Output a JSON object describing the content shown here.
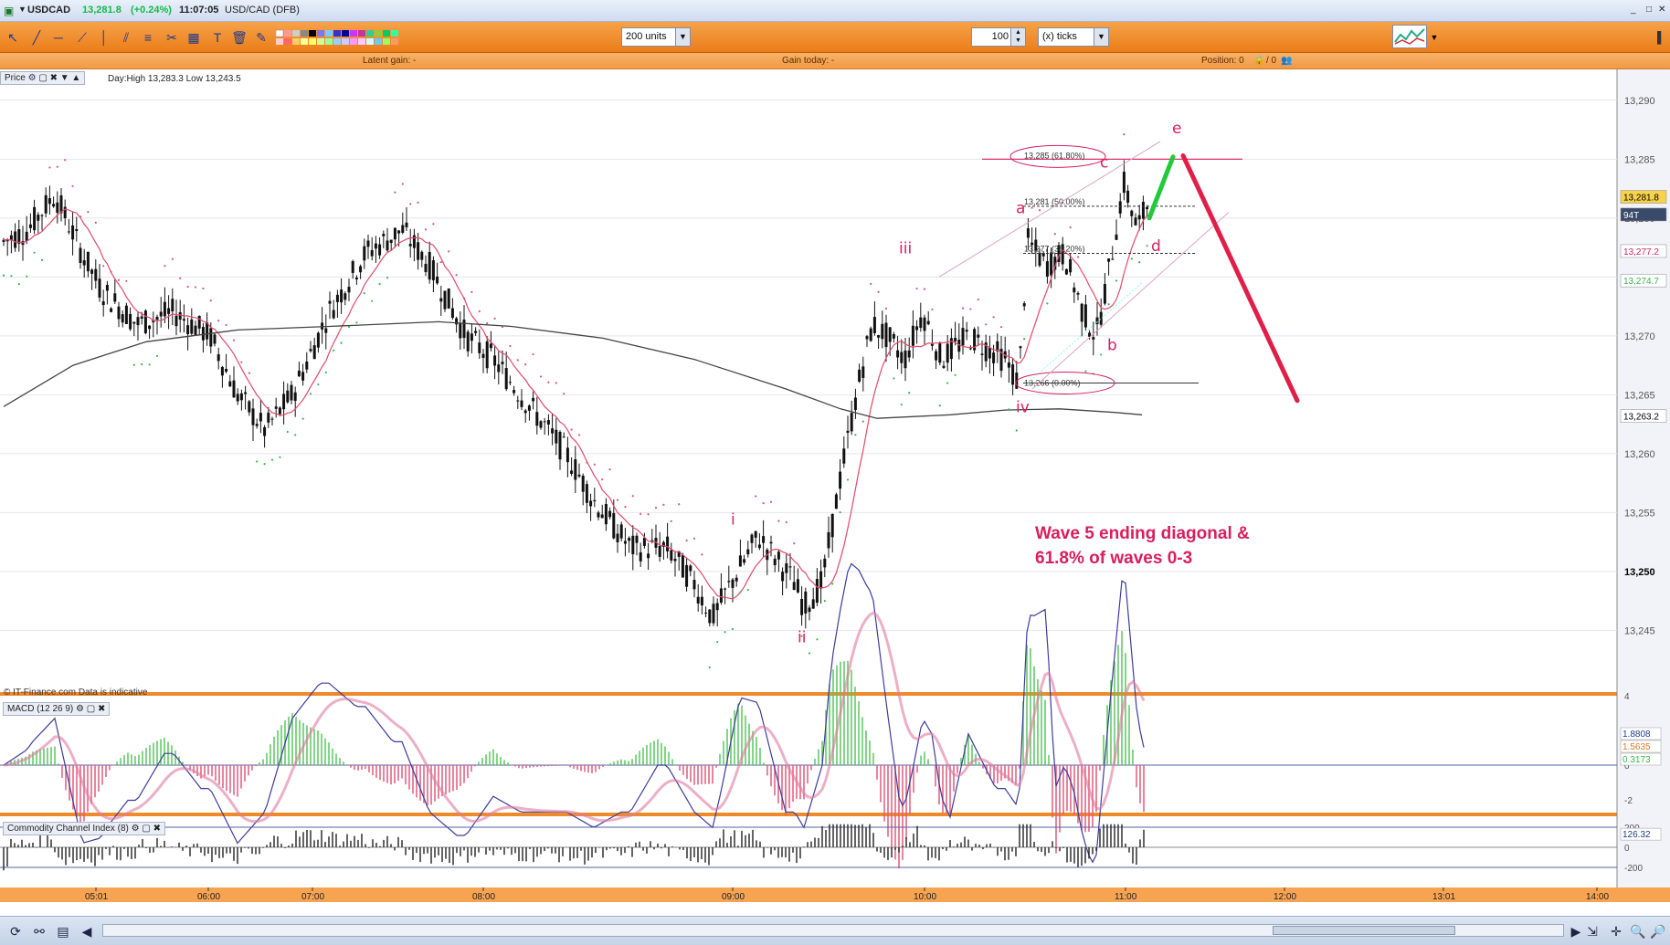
{
  "window": {
    "symbol": "USDCAD",
    "price": "13,281.8",
    "change": "(+0.24%)",
    "time": "11:07:05",
    "instrument": "USD/CAD (DFB)"
  },
  "toolbar": {
    "units_value": "200 units",
    "ticks_qty": "100",
    "ticks_label": "(x) ticks"
  },
  "infobar": {
    "latent_gain": "Latent gain: -",
    "gain_today": "Gain today: -",
    "position": "Position: 0",
    "position_sep": "/ 0"
  },
  "price_panel": {
    "label": "Price",
    "day_range": "Day:High 13,283.3 Low 13,243.5",
    "credit": "© IT-Finance.com  Data is indicative",
    "y_ticks": [
      "13,290",
      "13,285",
      "13,280",
      "13,275",
      "13,270",
      "13,265",
      "13,260",
      "13,255",
      "13,250",
      "13,245"
    ],
    "badges": [
      "13,281.8",
      "94T",
      "13,277.2",
      "13,274.7",
      "13,263.2"
    ],
    "fib_levels": [
      "13,285 (61.80%)",
      "13,281 (50.00%)",
      "13,277 (38.20%)",
      "13,266 (0.00%)"
    ],
    "wave_labels": [
      "i",
      "ii",
      "iii",
      "iv",
      "a",
      "b",
      "c",
      "d",
      "e"
    ],
    "annotation_line1": "Wave 5 ending diagonal &",
    "annotation_line2": "61.8% of waves 0-3"
  },
  "macd_panel": {
    "label": "MACD (12 26 9)",
    "y_ticks": [
      "4",
      "2",
      "0",
      "-2"
    ],
    "badges": [
      "1.8808",
      "1.5635",
      "0.3173"
    ]
  },
  "cci_panel": {
    "label": "Commodity Channel Index (8)",
    "y_ticks": [
      "200",
      "0",
      "-200"
    ],
    "badges": [
      "126.32"
    ]
  },
  "x_axis": {
    "ticks": [
      "05:01",
      "06:00",
      "07:00",
      "08:00",
      "09:00",
      "10:00",
      "11:00",
      "12:00",
      "13:01",
      "14:00"
    ]
  },
  "colors": {
    "toolbar": "#ef8a2a",
    "candle": "#111111",
    "ma_fast": "#e04a6a",
    "ma_slow": "#444444",
    "sar": "#3ab54a",
    "wave_label": "#d81e5b",
    "projection_up": "#22c93b",
    "projection_down": "#e01e48"
  }
}
